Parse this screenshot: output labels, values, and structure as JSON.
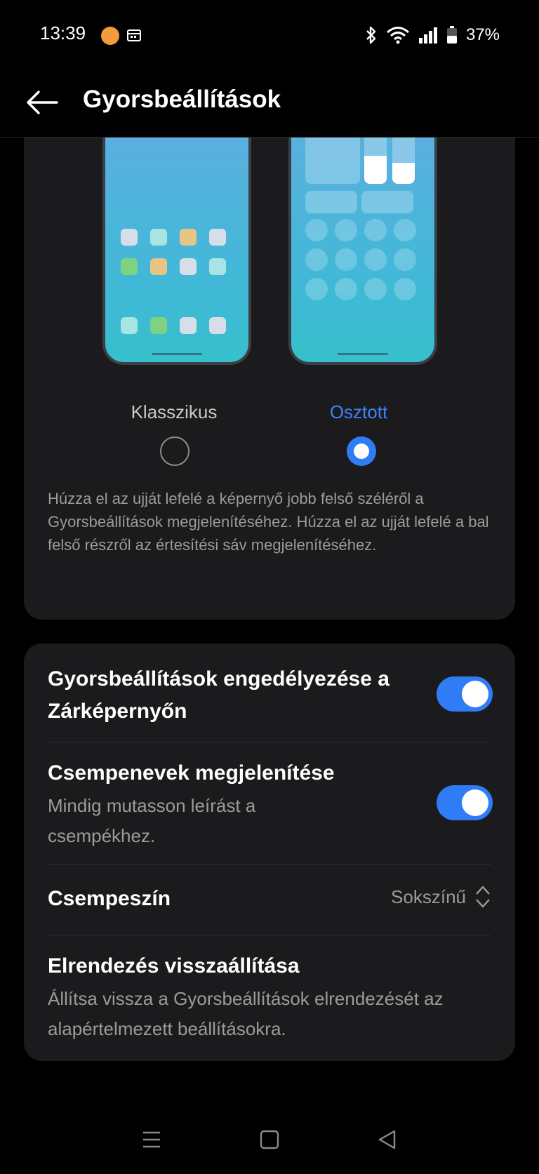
{
  "status_bar": {
    "time": "13:39",
    "battery_percent": "37%",
    "icons": [
      "app-notification-icon",
      "calendar-icon",
      "bluetooth-icon",
      "wifi-icon",
      "signal-icon",
      "battery-icon"
    ]
  },
  "header": {
    "title": "Gyorsbeállítások",
    "back_icon": "arrow-left-icon"
  },
  "layout_picker": {
    "options": [
      {
        "label": "Klasszikus",
        "selected": false
      },
      {
        "label": "Osztott",
        "selected": true
      }
    ],
    "description": "Húzza el az ujját lefelé a képernyő jobb felső széléről a Gyorsbeállítások megjelenítéséhez. Húzza el az ujját lefelé a bal felső részről az értesítési sáv megjelenítéséhez."
  },
  "settings": {
    "lockscreen": {
      "title": "Gyorsbeállítások engedélyezése a Zárképernyőn",
      "enabled": true
    },
    "tile_names": {
      "title": "Csempenevek megjelenítése",
      "subtitle": "Mindig mutasson leírást a csempékhez.",
      "enabled": true
    },
    "tile_color": {
      "title": "Csempeszín",
      "value": "Sokszínű"
    },
    "reset_layout": {
      "title": "Elrendezés visszaállítása",
      "subtitle": "Állítsa vissza a Gyorsbeállítások elrendezését az alapértelmezett beállításokra."
    }
  },
  "colors": {
    "accent": "#2f7cf6",
    "card_background": "#1b1b1d",
    "background": "#000000"
  }
}
